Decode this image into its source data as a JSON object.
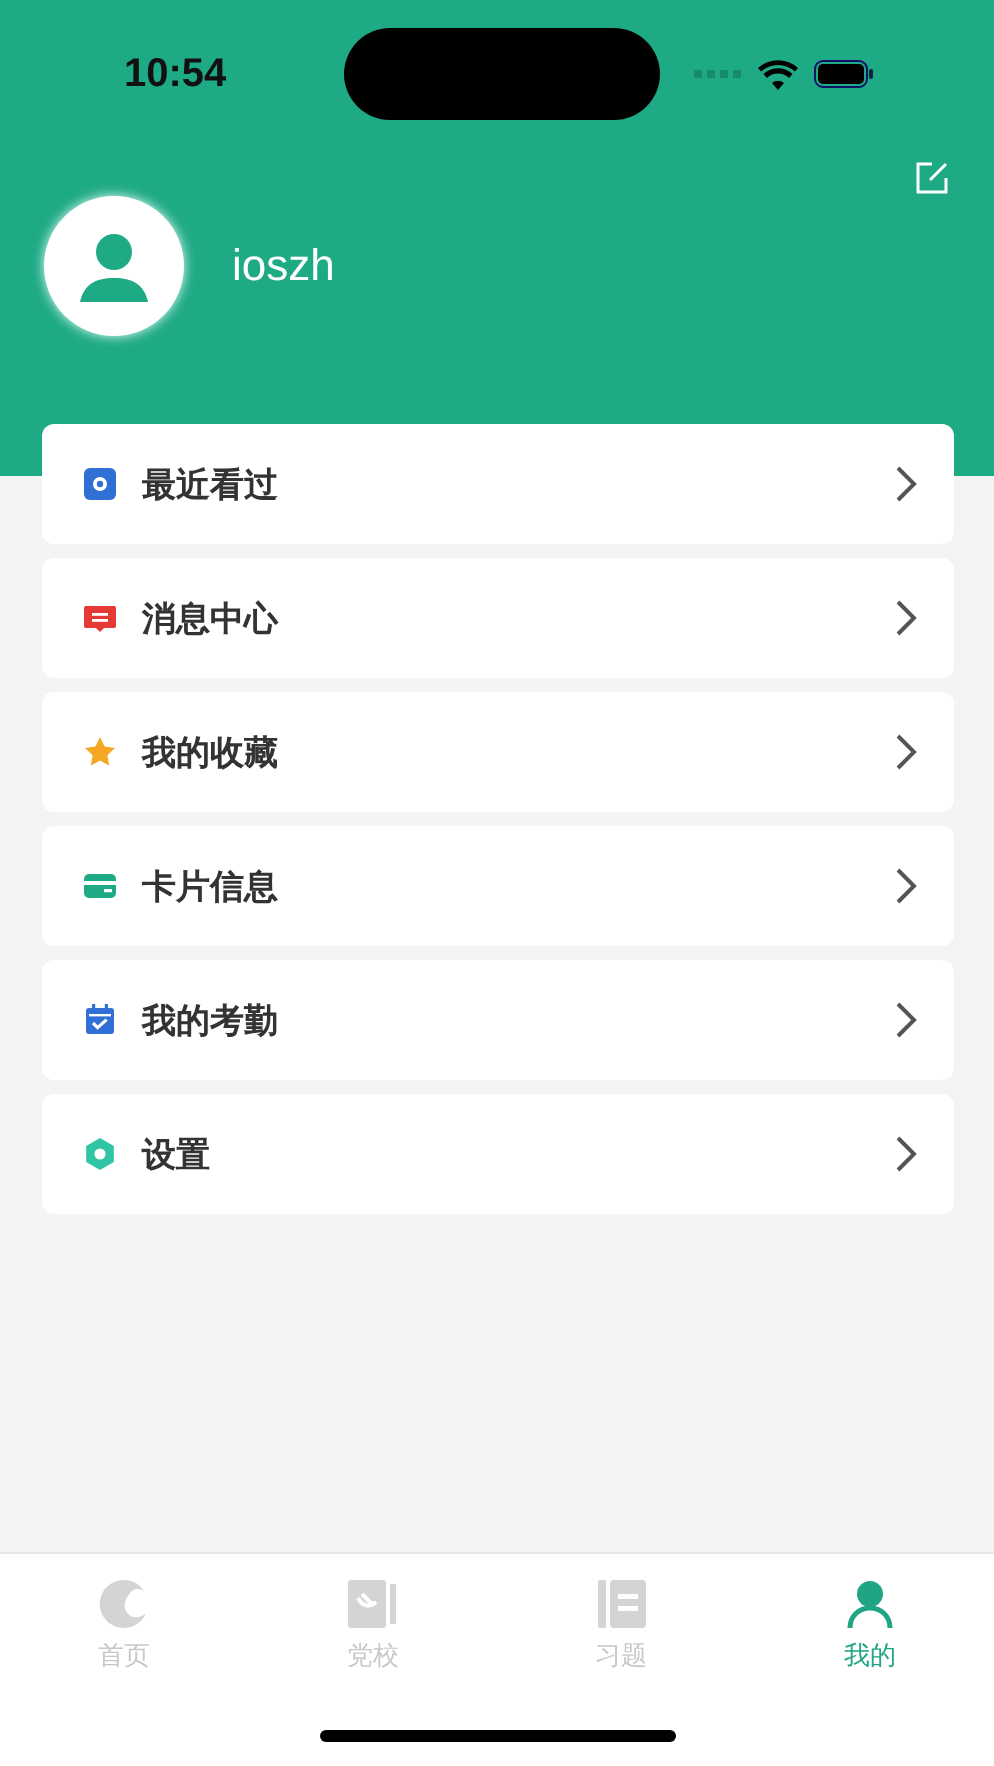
{
  "status_bar": {
    "time": "10:54"
  },
  "profile": {
    "username": "ioszh"
  },
  "menu": [
    {
      "label": "最近看过",
      "kind": "recent"
    },
    {
      "label": "消息中心",
      "kind": "message"
    },
    {
      "label": "我的收藏",
      "kind": "favorite"
    },
    {
      "label": "卡片信息",
      "kind": "card"
    },
    {
      "label": "我的考勤",
      "kind": "attendance"
    },
    {
      "label": "设置",
      "kind": "settings"
    }
  ],
  "tab_bar": [
    {
      "label": "首页",
      "kind": "home",
      "selected": false
    },
    {
      "label": "党校",
      "kind": "school",
      "selected": false
    },
    {
      "label": "习题",
      "kind": "exercise",
      "selected": false
    },
    {
      "label": "我的",
      "kind": "me",
      "selected": true
    }
  ]
}
